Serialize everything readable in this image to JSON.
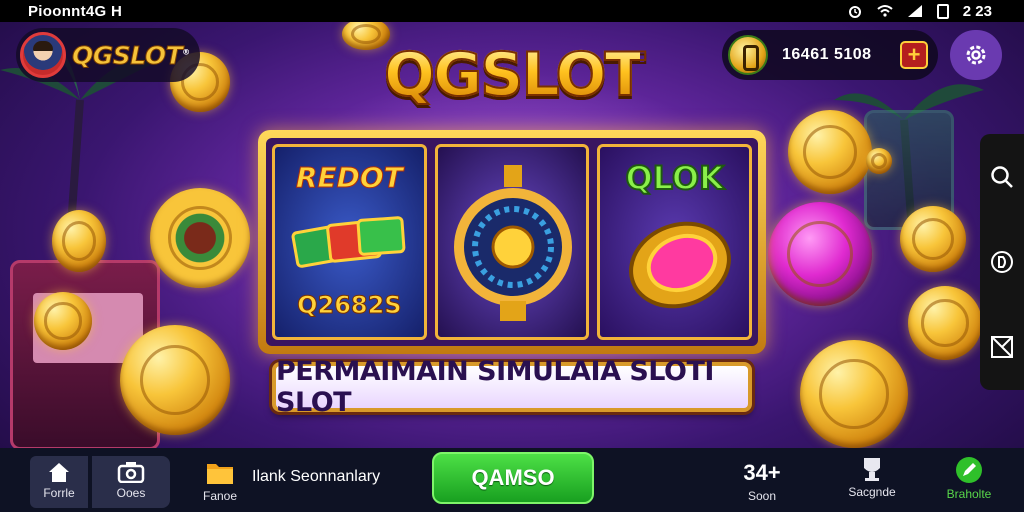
{
  "status_bar": {
    "left_text": "Pioonnt4G H",
    "time": "2 23"
  },
  "brand": {
    "name": "QGSLOT",
    "trademark": "®"
  },
  "wallet": {
    "balance": "16461 5108",
    "add_label": "+"
  },
  "hero": {
    "title": "QGSLOT"
  },
  "reels": {
    "reel1_top": "REDOT",
    "reel1_bottom": "Q2682S",
    "reel3_top": "QLOK"
  },
  "banner": {
    "text": "PERMAIMAIN SIMULAIA SLOTI SLOT"
  },
  "bottom_nav": {
    "home_label": "Forrle",
    "games_label": "Ooes",
    "folder_label": "Fanoe",
    "bank_text": "Ilank Seonnanlary",
    "play_label": "QAMSO",
    "count_value": "34+",
    "count_label": "Soon",
    "rank_label": "Sacgnde",
    "edit_label": "Braholte"
  },
  "colors": {
    "accent_gold": "#ffc21f",
    "play_green": "#2fc02a",
    "background_purple": "#5a2398"
  },
  "icons": {
    "side_dock": [
      "search-icon",
      "info-circle-icon",
      "expand-icon"
    ],
    "top_right": "gear-icon"
  }
}
